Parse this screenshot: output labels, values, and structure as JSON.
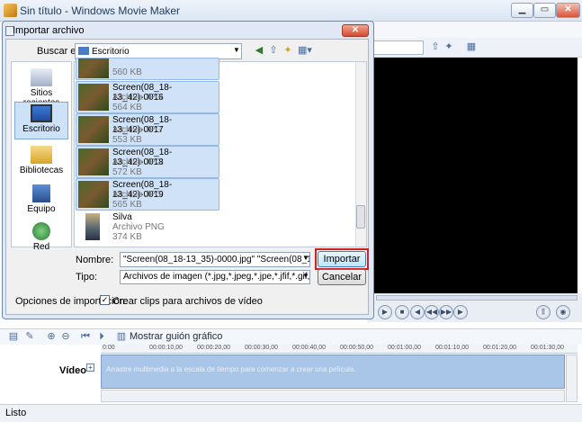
{
  "main": {
    "title": "Sin título - Windows Movie Maker",
    "window_buttons": {
      "minimize": "▁",
      "maximize": "▭",
      "close": "✕"
    },
    "status": "Listo",
    "storyboard_label": "Mostrar guión gráfico",
    "video_track_label": "Vídeo",
    "video_track_message": "Arrastre multimedia a la escala de tiempo para comenzar a crear una película.",
    "timeline_ticks": [
      "0:00",
      "00:00:10,00",
      "00:00:20,00",
      "00:00:30,00",
      "00:00:40,00",
      "00:00:50,00",
      "00:01:00,00",
      "00:01:10,00",
      "00:01:20,00",
      "00:01:30,00"
    ]
  },
  "dialog": {
    "title": "Importar archivo",
    "close": "✕",
    "look_in_label": "Buscar en:",
    "look_in_value": "Escritorio",
    "places": [
      {
        "label": "Sitios recientes",
        "icon": "recent-places-icon"
      },
      {
        "label": "Escritorio",
        "icon": "desktop-icon"
      },
      {
        "label": "Bibliotecas",
        "icon": "libraries-icon"
      },
      {
        "label": "Equipo",
        "icon": "computer-icon"
      },
      {
        "label": "Red",
        "icon": "network-icon"
      }
    ],
    "files": [
      {
        "name": "",
        "type": "",
        "size": "560 KB"
      },
      {
        "name": "Screen(08_18-13_42)-0016",
        "type": "Archivo JPG",
        "size": "564 KB"
      },
      {
        "name": "Screen(08_18-13_42)-0017",
        "type": "Archivo JPG",
        "size": "553 KB"
      },
      {
        "name": "Screen(08_18-13_42)-0018",
        "type": "Archivo JPG",
        "size": "572 KB"
      },
      {
        "name": "Screen(08_18-13_42)-0019",
        "type": "Archivo JPG",
        "size": "565 KB"
      },
      {
        "name": "Silva",
        "type": "Archivo PNG",
        "size": "374 KB"
      }
    ],
    "name_label": "Nombre:",
    "name_value": "\"Screen(08_18-13_35)-0000.jpg\" \"Screen(08_18-13_35)",
    "type_label": "Tipo:",
    "type_value": "Archivos de imagen (*.jpg,*.jpeg,*.jpe,*.jfif,*.gif,*.png,*.bm",
    "import_button": "Importar",
    "cancel_button": "Cancelar",
    "options_label": "Opciones de importación:",
    "options_checkbox_label": "Crear clips para archivos de vídeo",
    "options_checked": true
  },
  "colors": {
    "highlight": "#d22020",
    "selection": "#cfe2f8",
    "preview": "#000000"
  }
}
